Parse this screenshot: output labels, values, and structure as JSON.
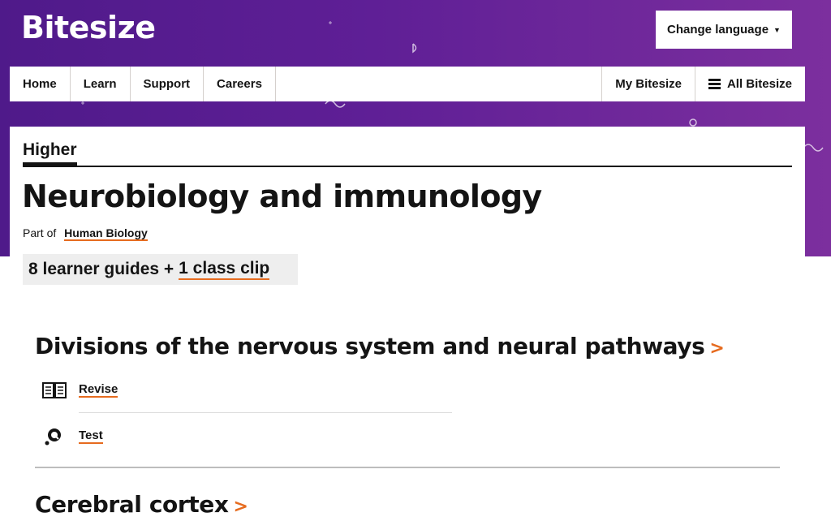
{
  "brand": {
    "logo": "Bitesize"
  },
  "header": {
    "language_button": "Change language"
  },
  "nav": {
    "left": [
      "Home",
      "Learn",
      "Support",
      "Careers"
    ],
    "my_bitesize": "My Bitesize",
    "all_bitesize": "All Bitesize"
  },
  "page": {
    "level": "Higher",
    "title": "Neurobiology and immunology",
    "part_of_label": "Part of",
    "part_of_link": "Human Biology",
    "guides_count": "8 learner guides +",
    "clip_link": "1 class clip"
  },
  "topics": [
    {
      "title": "Divisions of the nervous system and neural pathways",
      "arrow": ">",
      "links": [
        {
          "label": "Revise",
          "icon": "book-icon"
        },
        {
          "label": "Test",
          "icon": "quiz-icon"
        }
      ]
    },
    {
      "title": "Cerebral cortex",
      "arrow": ">"
    }
  ],
  "colors": {
    "purple_start": "#4f1a8a",
    "purple_end": "#7c2f9e",
    "accent_orange": "#e66b1f",
    "text": "#141414"
  }
}
